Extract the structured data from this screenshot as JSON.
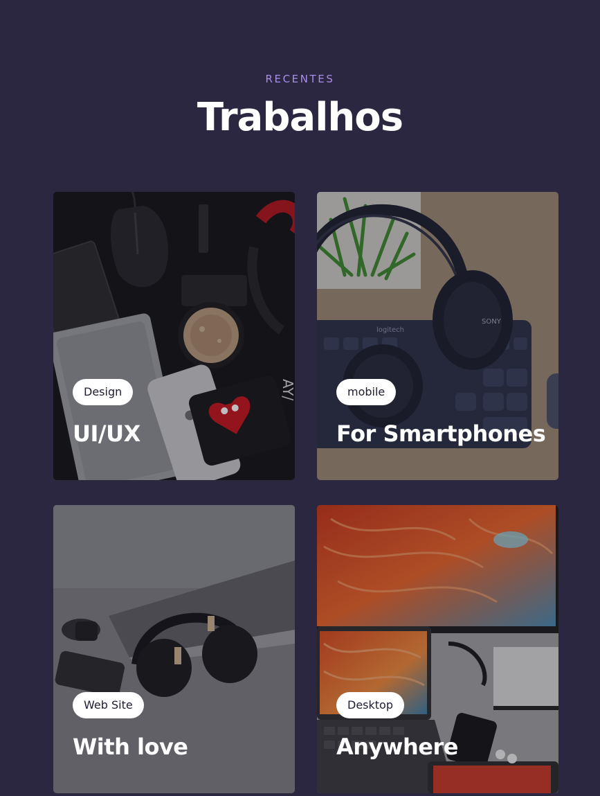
{
  "section": {
    "eyebrow": "RECENTES",
    "title": "Trabalhos"
  },
  "projects": [
    {
      "tag": "Design",
      "title": "UI/UX"
    },
    {
      "tag": "mobile",
      "title": "For Smartphones"
    },
    {
      "tag": "Web Site",
      "title": "With love"
    },
    {
      "tag": "Desktop",
      "title": "Anywhere"
    }
  ],
  "colors": {
    "background": "#2c2740",
    "eyebrow": "#a98fe8",
    "tag_bg": "#ffffff",
    "tag_text": "#1f1b33"
  }
}
